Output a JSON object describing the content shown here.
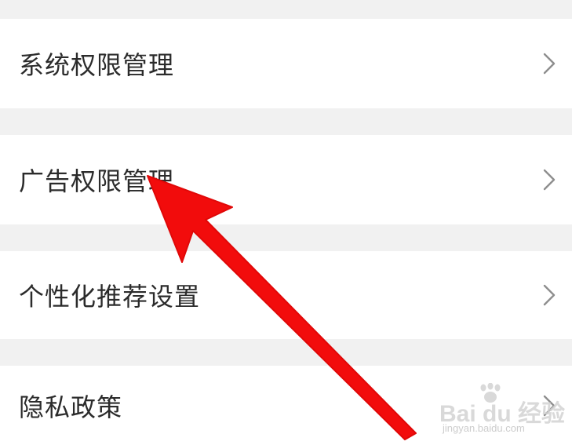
{
  "settings": {
    "items": [
      {
        "label": "系统权限管理"
      },
      {
        "label": "广告权限管理"
      },
      {
        "label": "个性化推荐设置"
      },
      {
        "label": "隐私政策"
      }
    ]
  },
  "watermark": {
    "brand": "Bai du 经验",
    "url": "jingyan.baidu.com"
  },
  "colors": {
    "background": "#f1f1f1",
    "row": "#ffffff",
    "text": "#2b2b2b",
    "chevron": "#8e8e8e",
    "arrow": "#f20c0c"
  }
}
